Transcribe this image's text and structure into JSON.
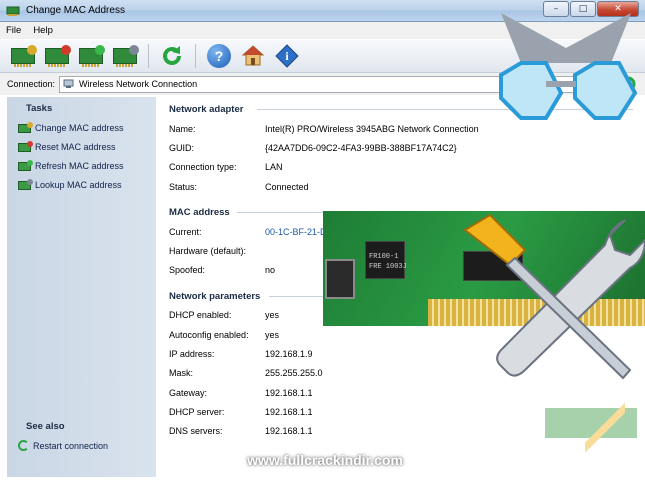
{
  "window": {
    "title": "Change MAC Address",
    "controls": {
      "minimize": "–",
      "maximize": "□",
      "close": "✕"
    }
  },
  "menu": {
    "items": [
      "File",
      "Help"
    ]
  },
  "toolbar": {
    "buttons": [
      {
        "name": "change-mac",
        "icon": "network-card-pencil-icon"
      },
      {
        "name": "reset-mac",
        "icon": "network-card-reset-icon"
      },
      {
        "name": "refresh-mac",
        "icon": "network-card-refresh-icon"
      },
      {
        "name": "lookup-mac",
        "icon": "network-card-lookup-icon"
      },
      {
        "name": "restart",
        "icon": "refresh-arrow-icon"
      },
      {
        "name": "help",
        "icon": "question-icon",
        "glyph": "?"
      },
      {
        "name": "home",
        "icon": "home-icon"
      },
      {
        "name": "about",
        "icon": "info-icon",
        "glyph": "i"
      }
    ]
  },
  "connection": {
    "label": "Connection:",
    "selected": "Wireless Network Connection"
  },
  "tasks": {
    "title": "Tasks",
    "items": [
      "Change MAC address",
      "Reset MAC address",
      "Refresh MAC address",
      "Lookup MAC address"
    ],
    "see_also_title": "See also",
    "see_also_items": [
      "Restart connection"
    ]
  },
  "network_adapter": {
    "title": "Network adapter",
    "rows": [
      {
        "label": "Name:",
        "value": "Intel(R) PRO/Wireless 3945ABG Network Connection"
      },
      {
        "label": "GUID:",
        "value": "{42AA7DD6-09C2-4FA3-99BB-388BF17A74C2}"
      },
      {
        "label": "Connection type:",
        "value": "LAN"
      },
      {
        "label": "Status:",
        "value": "Connected"
      }
    ]
  },
  "mac_address": {
    "title": "MAC address",
    "rows": [
      {
        "label": "Current:",
        "value": "00-1C-BF-21-D"
      },
      {
        "label": "Hardware (default):",
        "value": ""
      },
      {
        "label": "Spoofed:",
        "value": "no"
      }
    ]
  },
  "network_parameters": {
    "title": "Network parameters",
    "rows": [
      {
        "label": "DHCP enabled:",
        "value": "yes"
      },
      {
        "label": "Autoconfig enabled:",
        "value": "yes"
      },
      {
        "label": "IP address:",
        "value": "192.168.1.9"
      },
      {
        "label": "Mask:",
        "value": "255.255.255.0"
      },
      {
        "label": "Gateway:",
        "value": "192.168.1.1"
      },
      {
        "label": "DHCP server:",
        "value": "192.168.1.1"
      },
      {
        "label": "DNS servers:",
        "value": "192.168.1.1"
      }
    ]
  },
  "overlay": {
    "chip_label_1": "FR100-1",
    "chip_label_2": "FRE 1003J",
    "watermark": "www.fullcrackindir.com"
  },
  "colors": {
    "accent": "#1a5aa8",
    "panel": "#cfdbe8",
    "card_green": "#2f8a39",
    "restart_green": "#27a640"
  }
}
